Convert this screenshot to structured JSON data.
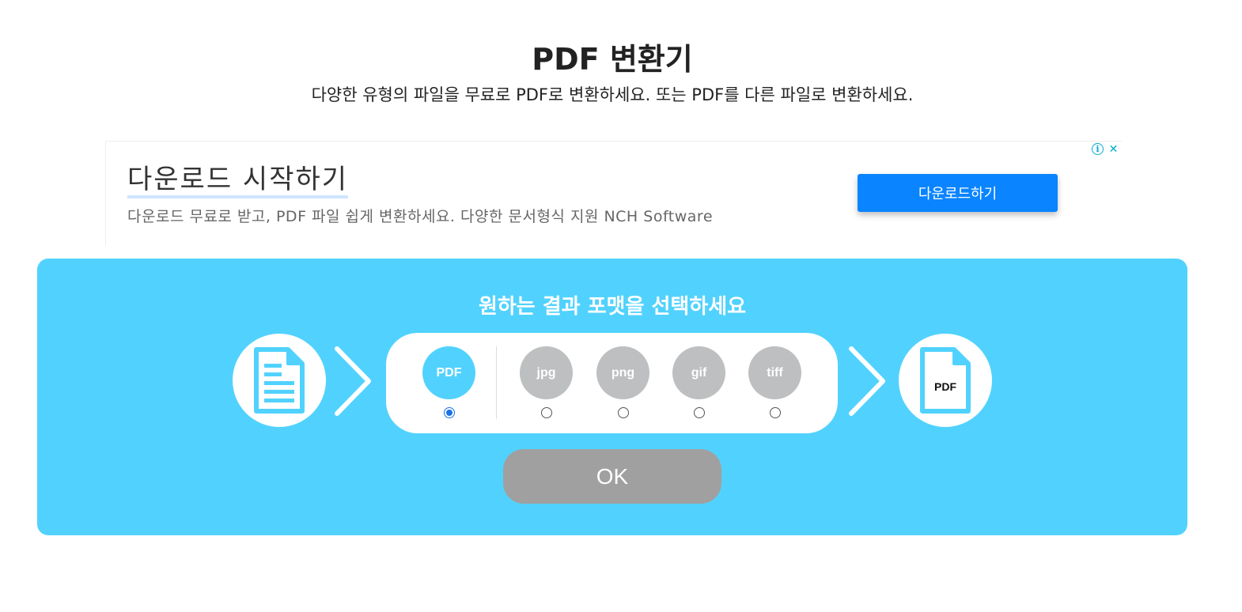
{
  "header": {
    "title": "PDF 변환기",
    "subtitle": "다양한 유형의 파일을 무료로 PDF로 변환하세요. 또는 PDF를 다른 파일로 변환하세요."
  },
  "ad": {
    "headline": "다운로드 시작하기",
    "description": "다운로드 무료로 받고, PDF 파일 쉽게 변환하세요. 다양한 문서형식 지원 NCH Software",
    "cta_label": "다운로드하기",
    "info_icon": "info-icon",
    "close_icon": "close-icon",
    "info_glyph": "i",
    "close_glyph": "✕"
  },
  "converter": {
    "heading": "원하는 결과 포맷을 선택하세요",
    "source_icon": "document-icon",
    "target_icon": "pdf-file-icon",
    "target_label": "PDF",
    "formats": [
      {
        "label": "PDF",
        "selected": true,
        "color": "#51d2fe"
      },
      {
        "label": "jpg",
        "selected": false,
        "color": "#bdbfc0"
      },
      {
        "label": "png",
        "selected": false,
        "color": "#bdbfc0"
      },
      {
        "label": "gif",
        "selected": false,
        "color": "#bdbfc0"
      },
      {
        "label": "tiff",
        "selected": false,
        "color": "#bdbfc0"
      }
    ],
    "ok_label": "OK"
  },
  "colors": {
    "panel": "#51d2fe",
    "cta": "#0a84ff",
    "ok_button": "#a0a0a0"
  }
}
